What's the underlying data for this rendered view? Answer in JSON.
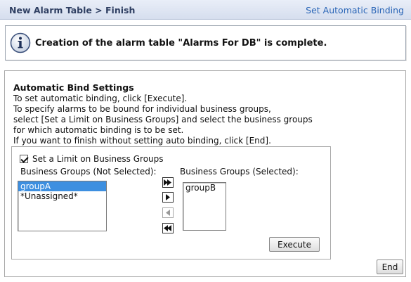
{
  "header": {
    "title": "New Alarm Table > Finish",
    "link": "Set Automatic Binding"
  },
  "message": {
    "icon": "info-icon",
    "text": "Creation of the alarm table \"Alarms For DB\" is complete."
  },
  "bind_settings": {
    "title": "Automatic Bind Settings",
    "lines": [
      "To set automatic binding, click [Execute].",
      "To specify alarms to be bound for individual business groups,",
      "select [Set a Limit on Business Groups] and select the business groups",
      "for which automatic binding is to be set.",
      "If you want to finish without setting auto binding, click [End]."
    ],
    "limit_checkbox": {
      "label": "Set a Limit on Business Groups",
      "checked": true
    },
    "not_selected": {
      "label": "Business Groups (Not Selected):",
      "items": [
        "groupA",
        "*Unassigned*"
      ],
      "selected_item": "groupA"
    },
    "selected": {
      "label": "Business Groups (Selected):",
      "items": [
        "groupB"
      ]
    },
    "arrows": [
      "move-all-right-icon",
      "move-right-icon",
      "move-left-icon",
      "move-all-left-icon"
    ],
    "execute_label": "Execute"
  },
  "end_label": "End",
  "colors": {
    "header_text": "#2f3f62",
    "link": "#2b66b7",
    "selection": "#3d8fe0"
  }
}
